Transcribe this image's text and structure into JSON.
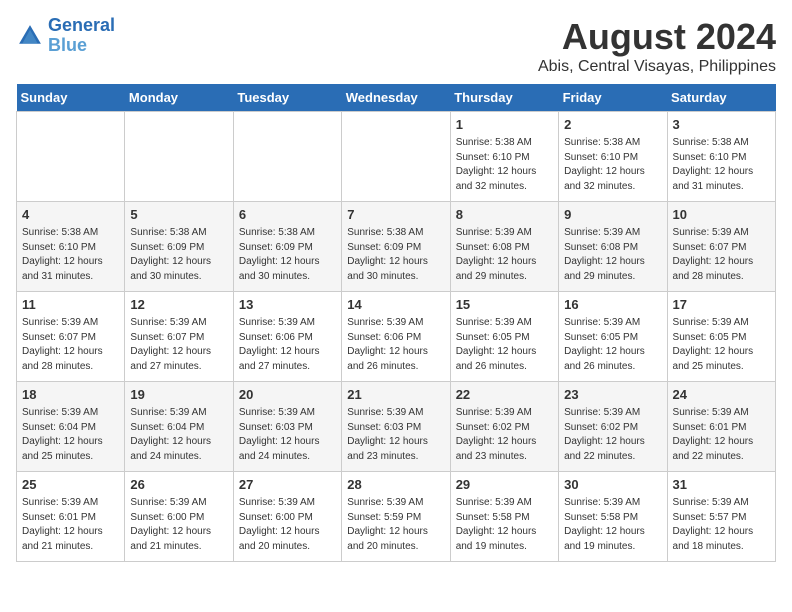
{
  "header": {
    "logo_line1": "General",
    "logo_line2": "Blue",
    "title": "August 2024",
    "subtitle": "Abis, Central Visayas, Philippines"
  },
  "days_of_week": [
    "Sunday",
    "Monday",
    "Tuesday",
    "Wednesday",
    "Thursday",
    "Friday",
    "Saturday"
  ],
  "weeks": [
    [
      {
        "day": "",
        "info": ""
      },
      {
        "day": "",
        "info": ""
      },
      {
        "day": "",
        "info": ""
      },
      {
        "day": "",
        "info": ""
      },
      {
        "day": "1",
        "info": "Sunrise: 5:38 AM\nSunset: 6:10 PM\nDaylight: 12 hours\nand 32 minutes."
      },
      {
        "day": "2",
        "info": "Sunrise: 5:38 AM\nSunset: 6:10 PM\nDaylight: 12 hours\nand 32 minutes."
      },
      {
        "day": "3",
        "info": "Sunrise: 5:38 AM\nSunset: 6:10 PM\nDaylight: 12 hours\nand 31 minutes."
      }
    ],
    [
      {
        "day": "4",
        "info": "Sunrise: 5:38 AM\nSunset: 6:10 PM\nDaylight: 12 hours\nand 31 minutes."
      },
      {
        "day": "5",
        "info": "Sunrise: 5:38 AM\nSunset: 6:09 PM\nDaylight: 12 hours\nand 30 minutes."
      },
      {
        "day": "6",
        "info": "Sunrise: 5:38 AM\nSunset: 6:09 PM\nDaylight: 12 hours\nand 30 minutes."
      },
      {
        "day": "7",
        "info": "Sunrise: 5:38 AM\nSunset: 6:09 PM\nDaylight: 12 hours\nand 30 minutes."
      },
      {
        "day": "8",
        "info": "Sunrise: 5:39 AM\nSunset: 6:08 PM\nDaylight: 12 hours\nand 29 minutes."
      },
      {
        "day": "9",
        "info": "Sunrise: 5:39 AM\nSunset: 6:08 PM\nDaylight: 12 hours\nand 29 minutes."
      },
      {
        "day": "10",
        "info": "Sunrise: 5:39 AM\nSunset: 6:07 PM\nDaylight: 12 hours\nand 28 minutes."
      }
    ],
    [
      {
        "day": "11",
        "info": "Sunrise: 5:39 AM\nSunset: 6:07 PM\nDaylight: 12 hours\nand 28 minutes."
      },
      {
        "day": "12",
        "info": "Sunrise: 5:39 AM\nSunset: 6:07 PM\nDaylight: 12 hours\nand 27 minutes."
      },
      {
        "day": "13",
        "info": "Sunrise: 5:39 AM\nSunset: 6:06 PM\nDaylight: 12 hours\nand 27 minutes."
      },
      {
        "day": "14",
        "info": "Sunrise: 5:39 AM\nSunset: 6:06 PM\nDaylight: 12 hours\nand 26 minutes."
      },
      {
        "day": "15",
        "info": "Sunrise: 5:39 AM\nSunset: 6:05 PM\nDaylight: 12 hours\nand 26 minutes."
      },
      {
        "day": "16",
        "info": "Sunrise: 5:39 AM\nSunset: 6:05 PM\nDaylight: 12 hours\nand 26 minutes."
      },
      {
        "day": "17",
        "info": "Sunrise: 5:39 AM\nSunset: 6:05 PM\nDaylight: 12 hours\nand 25 minutes."
      }
    ],
    [
      {
        "day": "18",
        "info": "Sunrise: 5:39 AM\nSunset: 6:04 PM\nDaylight: 12 hours\nand 25 minutes."
      },
      {
        "day": "19",
        "info": "Sunrise: 5:39 AM\nSunset: 6:04 PM\nDaylight: 12 hours\nand 24 minutes."
      },
      {
        "day": "20",
        "info": "Sunrise: 5:39 AM\nSunset: 6:03 PM\nDaylight: 12 hours\nand 24 minutes."
      },
      {
        "day": "21",
        "info": "Sunrise: 5:39 AM\nSunset: 6:03 PM\nDaylight: 12 hours\nand 23 minutes."
      },
      {
        "day": "22",
        "info": "Sunrise: 5:39 AM\nSunset: 6:02 PM\nDaylight: 12 hours\nand 23 minutes."
      },
      {
        "day": "23",
        "info": "Sunrise: 5:39 AM\nSunset: 6:02 PM\nDaylight: 12 hours\nand 22 minutes."
      },
      {
        "day": "24",
        "info": "Sunrise: 5:39 AM\nSunset: 6:01 PM\nDaylight: 12 hours\nand 22 minutes."
      }
    ],
    [
      {
        "day": "25",
        "info": "Sunrise: 5:39 AM\nSunset: 6:01 PM\nDaylight: 12 hours\nand 21 minutes."
      },
      {
        "day": "26",
        "info": "Sunrise: 5:39 AM\nSunset: 6:00 PM\nDaylight: 12 hours\nand 21 minutes."
      },
      {
        "day": "27",
        "info": "Sunrise: 5:39 AM\nSunset: 6:00 PM\nDaylight: 12 hours\nand 20 minutes."
      },
      {
        "day": "28",
        "info": "Sunrise: 5:39 AM\nSunset: 5:59 PM\nDaylight: 12 hours\nand 20 minutes."
      },
      {
        "day": "29",
        "info": "Sunrise: 5:39 AM\nSunset: 5:58 PM\nDaylight: 12 hours\nand 19 minutes."
      },
      {
        "day": "30",
        "info": "Sunrise: 5:39 AM\nSunset: 5:58 PM\nDaylight: 12 hours\nand 19 minutes."
      },
      {
        "day": "31",
        "info": "Sunrise: 5:39 AM\nSunset: 5:57 PM\nDaylight: 12 hours\nand 18 minutes."
      }
    ]
  ]
}
